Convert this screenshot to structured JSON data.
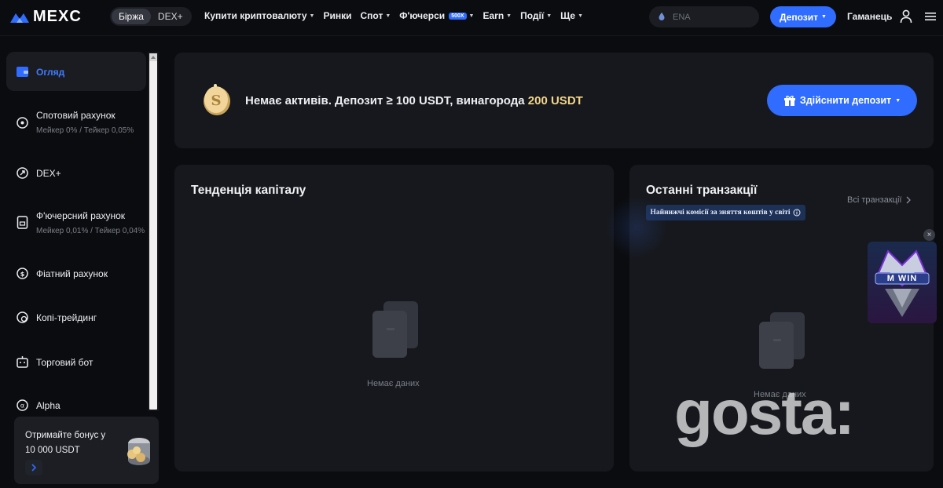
{
  "header": {
    "brand": "MEXC",
    "modes": [
      "Біржа",
      "DEX+"
    ],
    "active_mode": 0,
    "nav": [
      {
        "label": "Купити криптовалюту",
        "has_caret": true
      },
      {
        "label": "Ринки",
        "has_caret": false
      },
      {
        "label": "Спот",
        "has_caret": true
      },
      {
        "label": "Ф'ючерси",
        "has_caret": true,
        "badge": "500X"
      },
      {
        "label": "Earn",
        "has_caret": true
      },
      {
        "label": "Події",
        "has_caret": true
      },
      {
        "label": "Ще",
        "has_caret": true
      }
    ],
    "search_placeholder": "ENA",
    "deposit_label": "Депозит",
    "wallet_label": "Гаманець",
    "accent": "#2f6cff"
  },
  "sidebar": {
    "items": [
      {
        "label": "Огляд",
        "sub": "",
        "icon": "wallet-icon",
        "active": true
      },
      {
        "label": "Спотовий рахунок",
        "sub": "Мейкер 0% / Тейкер 0,05%",
        "icon": "target-icon"
      },
      {
        "label": "DEX+",
        "sub": "",
        "icon": "dex-icon"
      },
      {
        "label": "Ф'ючерсний рахунок",
        "sub": "Мейкер 0,01% / Тейкер 0,04%",
        "icon": "futures-doc-icon"
      },
      {
        "label": "Фіатний рахунок",
        "sub": "",
        "icon": "fiat-coin-icon"
      },
      {
        "label": "Копі-трейдинг",
        "sub": "",
        "icon": "copy-trade-icon"
      },
      {
        "label": "Торговий бот",
        "sub": "",
        "icon": "robot-icon"
      },
      {
        "label": "Alpha",
        "sub": "",
        "icon": "alpha-icon"
      }
    ],
    "bonus": {
      "line1": "Отримайте бонус у",
      "line2": "10 000 USDT"
    }
  },
  "promo": {
    "text": "Немає активів. Депозит ≥ 100 USDT, винагорода",
    "reward": "200 USDT",
    "button": "Здійснити депозит",
    "reward_color": "#f3d58a"
  },
  "equity": {
    "title": "Тенденція капіталу",
    "empty": "Немає даних"
  },
  "transactions": {
    "title": "Останні транзакції",
    "banner": "Найнижчі комісії за зняття коштів у світі",
    "all_link": "Всі транзакції",
    "empty": "Немає даних"
  },
  "float_ad": {
    "title": "M WIN"
  },
  "watermark": "gosta:"
}
